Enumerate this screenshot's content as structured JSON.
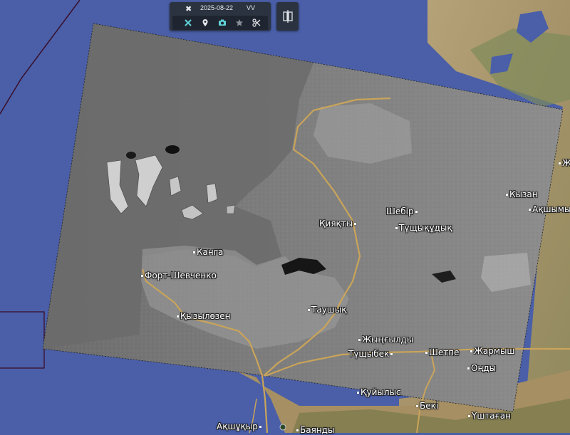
{
  "toolbar": {
    "date": "2025-08-22",
    "polarization": "VV",
    "icons": [
      "crossed-tools-icon",
      "location-pin-icon",
      "camera-icon",
      "star-icon",
      "scissors-icon"
    ]
  },
  "side_button": {
    "icon": "compare-split-icon"
  },
  "colors": {
    "sea": "#4a5fa8",
    "scene_overlay": "#8a8a8a",
    "road": "#c9a45a",
    "toolbar_bg": "#2b3340",
    "toolbar_icon_accent": "#5fd3d8"
  },
  "places": [
    {
      "name": "Кызан",
      "dot": true
    },
    {
      "name": "Ақшымы",
      "dot": true
    },
    {
      "name": "Шебір",
      "dot": true
    },
    {
      "name": "Қияқты",
      "dot": true
    },
    {
      "name": "Түщықұдық",
      "dot": true
    },
    {
      "name": "Канга",
      "dot": true
    },
    {
      "name": "Форт-Шевченко",
      "dot": true
    },
    {
      "name": "Қызылөзен",
      "dot": true
    },
    {
      "name": "Таушық",
      "dot": true
    },
    {
      "name": "Жыңғылды",
      "dot": true
    },
    {
      "name": "Түщыбек",
      "dot": true
    },
    {
      "name": "Шетпе",
      "dot": true
    },
    {
      "name": "Жармыш",
      "dot": true
    },
    {
      "name": "Оңды",
      "dot": true
    },
    {
      "name": "Қуйылыс",
      "dot": true
    },
    {
      "name": "Бекі",
      "dot": true
    },
    {
      "name": "Үштаған",
      "dot": true
    },
    {
      "name": "Ақшұқыр",
      "dot": true
    },
    {
      "name": "Баянды",
      "dot": true
    },
    {
      "name": "Ж",
      "dot": true
    }
  ]
}
